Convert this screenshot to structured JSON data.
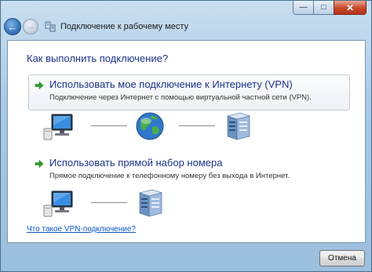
{
  "window": {
    "title": "Подключение к рабочему месту",
    "minimize_glyph": "—",
    "maximize_glyph": "□",
    "close_glyph": "✕",
    "back_glyph": "←",
    "forward_glyph": "→"
  },
  "main": {
    "heading": "Как выполнить подключение?",
    "options": [
      {
        "title": "Использовать мое подключение к Интернету (VPN)",
        "description": "Подключение через Интернет с помощью виртуальной частной сети (VPN).",
        "icon": "green-arrow-icon",
        "diagram": [
          "computer-icon",
          "globe-icon",
          "server-icon"
        ]
      },
      {
        "title": "Использовать прямой набор номера",
        "description": "Прямое подключение к телефонному номеру без выхода в Интернет.",
        "icon": "green-arrow-icon",
        "diagram": [
          "computer-icon",
          "server-icon"
        ]
      }
    ],
    "help_link": "Что такое VPN-подключение?"
  },
  "footer": {
    "cancel_label": "Отмена"
  },
  "colors": {
    "heading": "#1e3287",
    "link": "#0b55c4",
    "close_button": "#c7472b",
    "accent_arrow": "#2fa12f"
  }
}
